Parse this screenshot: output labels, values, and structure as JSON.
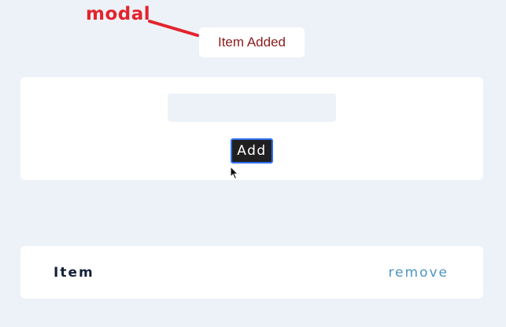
{
  "annotation": {
    "label": "modal",
    "color": "#e3232d"
  },
  "toast": {
    "message": "Item Added"
  },
  "form": {
    "input_value": "",
    "input_placeholder": "",
    "add_label": "Add"
  },
  "list": {
    "items": [
      {
        "label": "Item",
        "remove_label": "remove"
      }
    ]
  },
  "colors": {
    "background": "#edf2f8",
    "card": "#ffffff",
    "toast_text": "#8c1c1c",
    "button_bg": "#202020",
    "button_border": "#2f6ff0",
    "item_text": "#14213a",
    "remove_link": "#4c95c4"
  }
}
